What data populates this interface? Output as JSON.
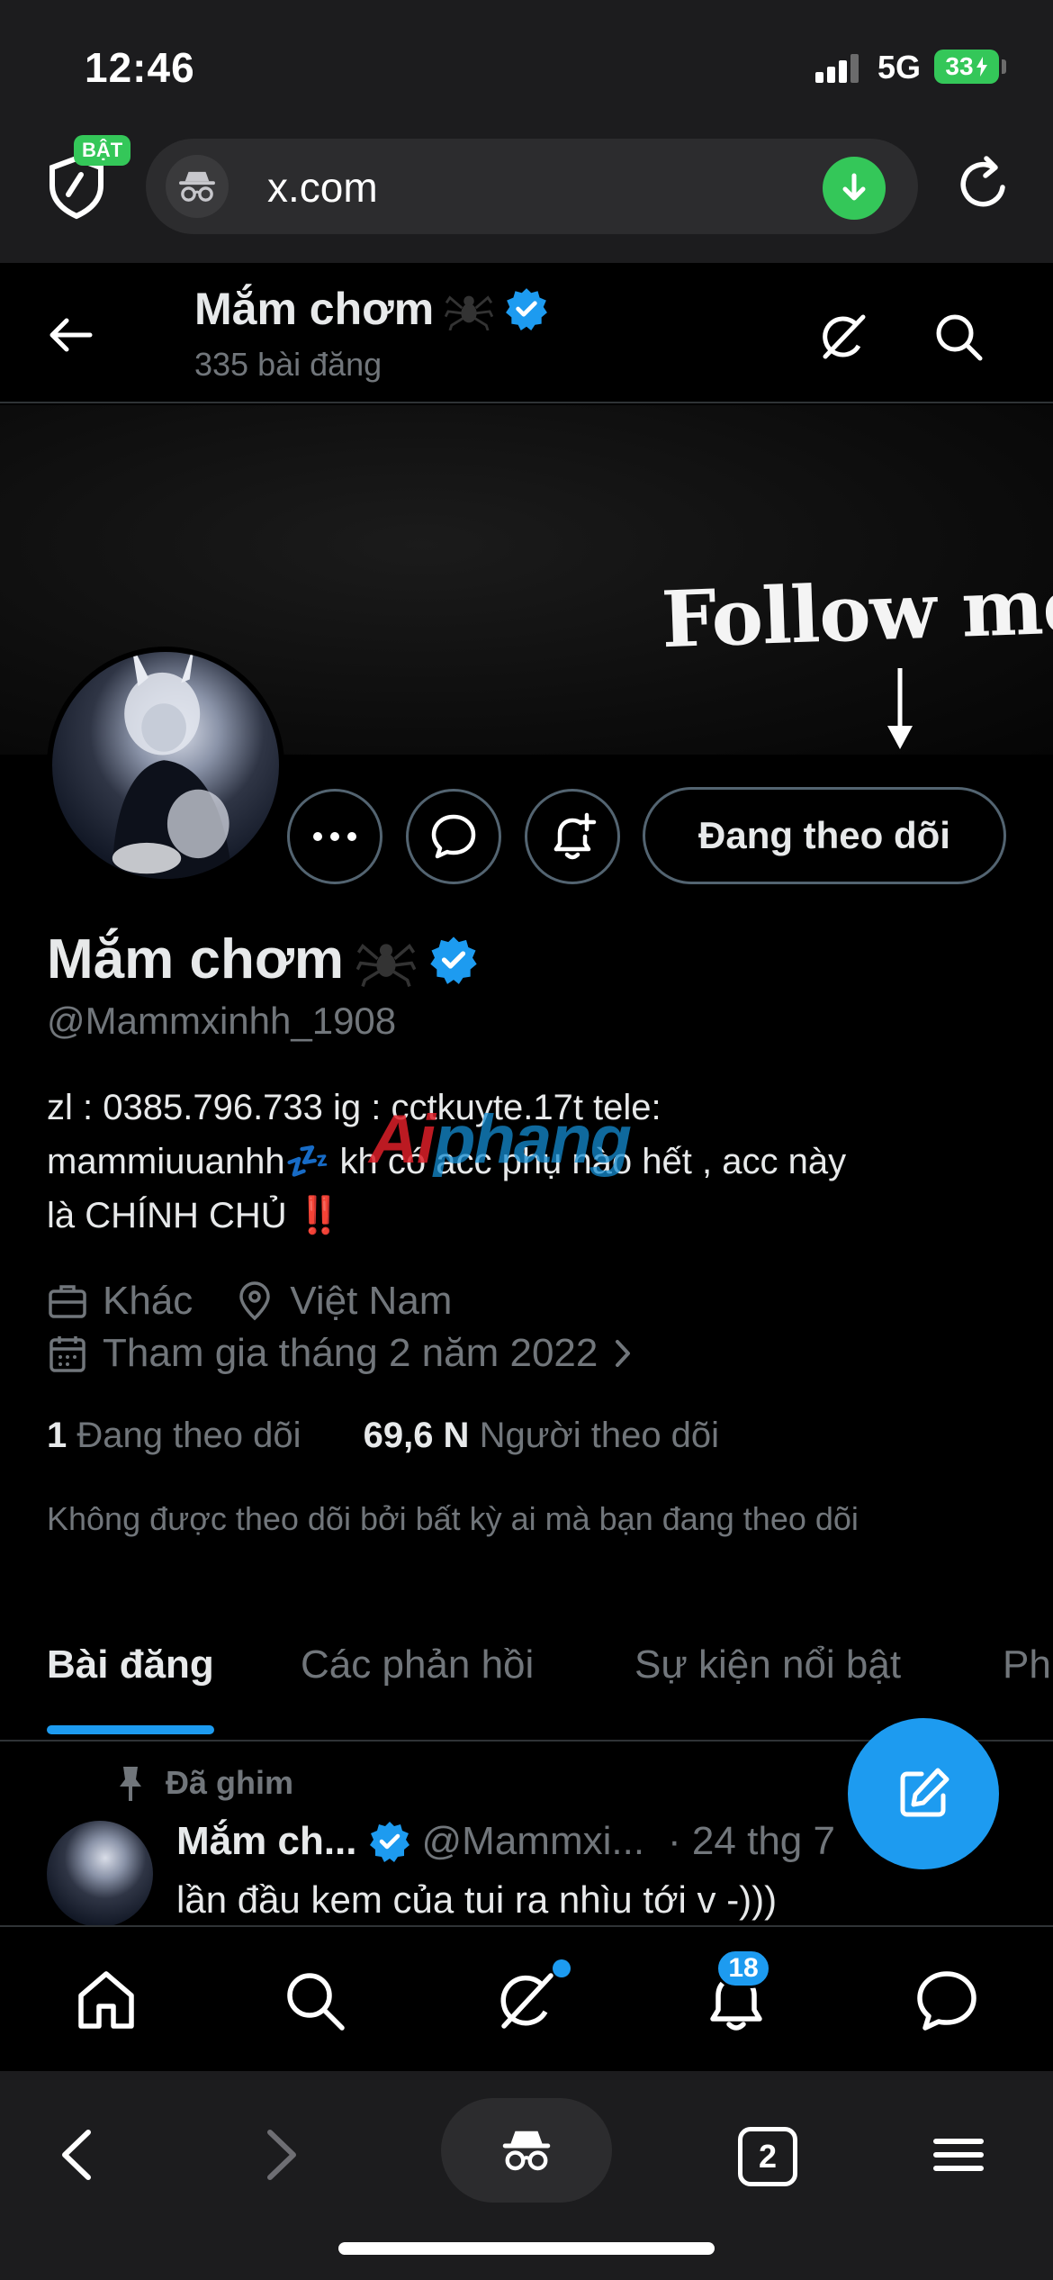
{
  "status_bar": {
    "time": "12:46",
    "network": "5G",
    "battery": "33"
  },
  "browser": {
    "shield_badge": "BẬT",
    "url": "x.com",
    "tab_count": "2"
  },
  "header": {
    "name": "Mắm chơm",
    "post_count": "335 bài đăng"
  },
  "banner": {
    "text": "Follow me"
  },
  "profile": {
    "follow_button": "Đang theo dõi",
    "name": "Mắm chơm",
    "handle": "@Mammxinhh_1908",
    "bio_line1": "zl : 0385.796.733 ig : cctkuyte.17t  tele:",
    "bio_line2": "mammiuuanhh💤 kh có acc phụ nào hết , acc này",
    "bio_line3": "là CHÍNH CHỦ",
    "bio_emoji": "‼️",
    "category": "Khác",
    "location": "Việt Nam",
    "joined": "Tham gia tháng 2 năm 2022",
    "following_count": "1",
    "following_label": "Đang theo dõi",
    "followers_count": "69,6 N",
    "followers_label": "Người theo dõi",
    "not_followed": "Không được theo dõi bởi bất kỳ ai mà bạn đang theo dõi"
  },
  "tabs": [
    {
      "label": "Bài đăng"
    },
    {
      "label": "Các phản hồi"
    },
    {
      "label": "Sự kiện nổi bật"
    },
    {
      "label": "Ph"
    }
  ],
  "pinned_post": {
    "pinned_label": "Đã ghim",
    "author": "Mắm ch...",
    "handle": "@Mammxi...",
    "time": "· 24 thg 7",
    "text": "lần đầu kem của tui ra nhìu tới v -)))"
  },
  "bottom_nav": {
    "notifications_badge": "18"
  },
  "watermark": {
    "prefix": "Ai",
    "suffix": "phang"
  },
  "colors": {
    "accent": "#1d9bf0",
    "verified": "#1d9bf0",
    "green": "#34c759",
    "alert": "#f4212e"
  }
}
